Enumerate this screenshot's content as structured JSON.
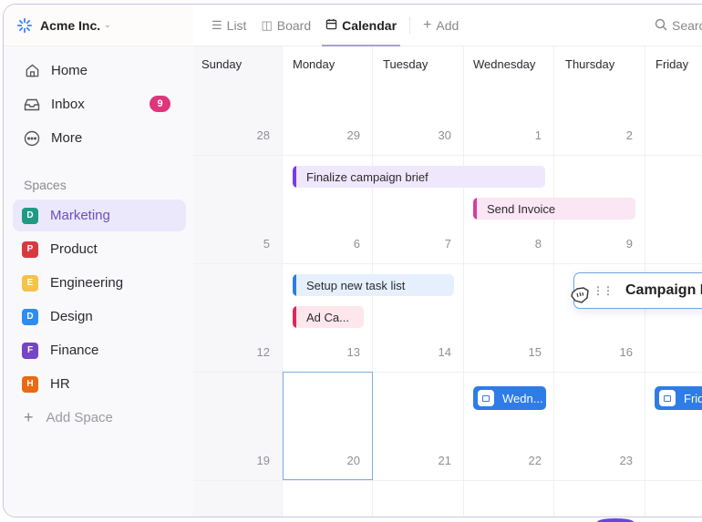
{
  "workspace": {
    "name": "Acme Inc.",
    "logo_icon": "spinner-logo-icon"
  },
  "nav": [
    {
      "label": "Home",
      "icon": "home-icon"
    },
    {
      "label": "Inbox",
      "icon": "inbox-icon",
      "badge": "9"
    },
    {
      "label": "More",
      "icon": "more-icon"
    }
  ],
  "spaces": {
    "label": "Spaces",
    "items": [
      {
        "label": "Marketing",
        "letter": "D",
        "color": "#1f9a83",
        "active": true
      },
      {
        "label": "Product",
        "letter": "P",
        "color": "#d8393f"
      },
      {
        "label": "Engineering",
        "letter": "E",
        "color": "#f5c24a"
      },
      {
        "label": "Design",
        "letter": "D",
        "color": "#2d8df0"
      },
      {
        "label": "Finance",
        "letter": "F",
        "color": "#7445c4"
      },
      {
        "label": "HR",
        "letter": "H",
        "color": "#ea6a12"
      }
    ],
    "add_label": "Add Space"
  },
  "tabs": [
    {
      "label": "List",
      "icon": "list-icon"
    },
    {
      "label": "Board",
      "icon": "board-icon"
    },
    {
      "label": "Calendar",
      "icon": "calendar-icon",
      "active": true
    },
    {
      "label": "Add",
      "icon": "plus-icon"
    }
  ],
  "search": {
    "label": "Search"
  },
  "calendar": {
    "days": [
      "Sunday",
      "Monday",
      "Tuesday",
      "Wednesday",
      "Thursday",
      "Friday"
    ],
    "weeks": [
      [
        "28",
        "29",
        "30",
        "1",
        "2",
        ""
      ],
      [
        "5",
        "6",
        "7",
        "8",
        "9",
        ""
      ],
      [
        "12",
        "13",
        "14",
        "15",
        "16",
        ""
      ],
      [
        "19",
        "20",
        "21",
        "22",
        "23",
        ""
      ]
    ],
    "today": "20",
    "events": [
      {
        "title": "Finalize campaign brief",
        "bar": "#7c3aed",
        "bg": "#efe7fb"
      },
      {
        "title": "Send Invoice",
        "bar": "#d63ea0",
        "bg": "#fbe6f5"
      },
      {
        "title": "Setup new task list",
        "bar": "#2d7de0",
        "bg": "#e6f0fd"
      },
      {
        "title": "Ad Ca...",
        "bar": "#e0255c",
        "bg": "#fde7ec"
      }
    ],
    "dragging": {
      "title": "Campaign Launch"
    },
    "chips": [
      {
        "title": "Wedn..."
      },
      {
        "title": "Friday"
      }
    ]
  }
}
